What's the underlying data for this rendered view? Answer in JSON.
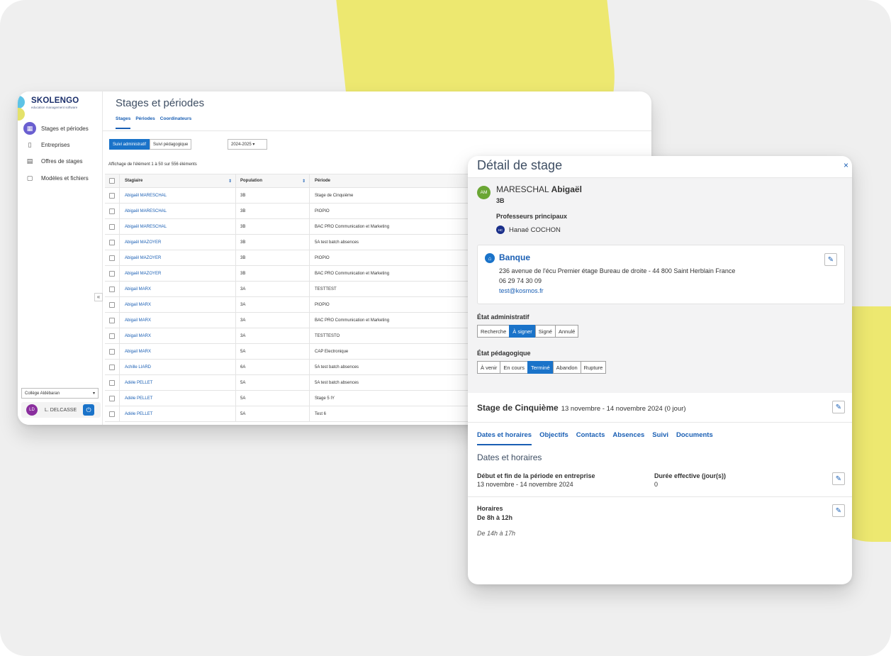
{
  "brand": {
    "name": "SKOLENGO",
    "tagline": "education management software"
  },
  "sidebar": {
    "items": [
      {
        "label": "Stages et périodes",
        "icon": "calendar-icon"
      },
      {
        "label": "Entreprises",
        "icon": "building-icon"
      },
      {
        "label": "Offres de stages",
        "icon": "document-icon"
      },
      {
        "label": "Modèles et fichiers",
        "icon": "file-icon"
      }
    ],
    "collapse": "«",
    "school": "Collège Aldébaran",
    "user": {
      "initials": "LD",
      "name": "L. DELCASSE"
    }
  },
  "main": {
    "title": "Stages et périodes",
    "tabs": [
      "Stages",
      "Périodes",
      "Coordinateurs"
    ],
    "follow_buttons": [
      "Suivi administratif",
      "Suivi pédagogique"
    ],
    "year": "2024-2025",
    "count_text": "Affichage de l'élément 1 à 50 sur 556 éléments",
    "table": {
      "headers": [
        "Stagiaire",
        "Population",
        "Période"
      ],
      "rows": [
        [
          "Abigaël MARESCHAL",
          "3B",
          "Stage de Cinquième"
        ],
        [
          "Abigaël MARESCHAL",
          "3B",
          "PIOPIO"
        ],
        [
          "Abigaël MARESCHAL",
          "3B",
          "BAC PRO Communication et Marketing"
        ],
        [
          "Abigaël MAZOYER",
          "3B",
          "5A test batch absences"
        ],
        [
          "Abigaël MAZOYER",
          "3B",
          "PIOPIO"
        ],
        [
          "Abigaël MAZOYER",
          "3B",
          "BAC PRO Communication et Marketing"
        ],
        [
          "Abigail MARX",
          "3A",
          "TESTTEST"
        ],
        [
          "Abigail MARX",
          "3A",
          "PIOPIO"
        ],
        [
          "Abigail MARX",
          "3A",
          "BAC PRO Communication et Marketing"
        ],
        [
          "Abigail MARX",
          "3A",
          "TESTTESTO"
        ],
        [
          "Abigail MARX",
          "5A",
          "CAP Electronique"
        ],
        [
          "Achille LIARD",
          "6A",
          "5A test batch absences"
        ],
        [
          "Adèle PELLET",
          "5A",
          "5A test batch absences"
        ],
        [
          "Adèle PELLET",
          "5A",
          "Stage 5 IY"
        ],
        [
          "Adèle PELLET",
          "5A",
          "Test 6"
        ]
      ]
    }
  },
  "detail": {
    "title": "Détail de stage",
    "close": "×",
    "student": {
      "initials": "AM",
      "last_name": "MARESCHAL",
      "first_name": "Abigaël",
      "class": "3B"
    },
    "prof_label": "Professeurs principaux",
    "prof": {
      "initials": "HC",
      "name": "Hanaé COCHON"
    },
    "company": {
      "name": "Banque",
      "address": "236 avenue de l'écu Premier étage Bureau de droite - 44 800 Saint Herblain France",
      "phone": "06 29 74 30 09",
      "email": "test@kosmos.fr"
    },
    "admin_state": {
      "label": "État administratif",
      "options": [
        "Recherche",
        "À signer",
        "Signé",
        "Annulé"
      ],
      "selected": "À signer"
    },
    "peda_state": {
      "label": "État pédagogique",
      "options": [
        "À venir",
        "En cours",
        "Terminé",
        "Abandon",
        "Rupture"
      ],
      "selected": "Terminé"
    },
    "stage": {
      "name": "Stage de Cinquième",
      "dates": "13 novembre - 14 novembre 2024 (0 jour)"
    },
    "tabs": [
      "Dates et horaires",
      "Objectifs",
      "Contacts",
      "Absences",
      "Suivi",
      "Documents"
    ],
    "section_title": "Dates et horaires",
    "period_label": "Début et fin de la période en entreprise",
    "period_value": "13 novembre - 14 novembre 2024",
    "duration_label": "Durée effective (jour(s))",
    "duration_value": "0",
    "hours_label": "Horaires",
    "hours_main": "De 8h à 12h",
    "hours_extra": "De 14h à 17h"
  },
  "colors": {
    "accent": "#1a73c9",
    "link": "#1a5fb4",
    "highlight": "#ede870",
    "background": "#efefef"
  }
}
